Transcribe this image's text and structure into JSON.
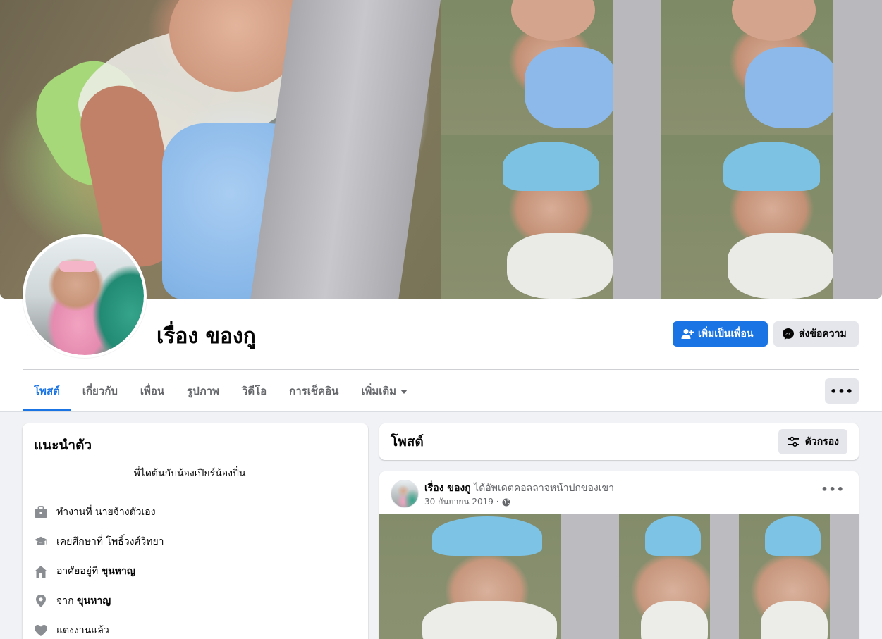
{
  "profile": {
    "name": "เรื่อง ของกู",
    "add_friend_label": "เพิ่มเป็นเพื่อน",
    "message_label": "ส่งข้อความ"
  },
  "tabs": [
    {
      "label": "โพสต์",
      "active": true
    },
    {
      "label": "เกี่ยวกับ",
      "active": false
    },
    {
      "label": "เพื่อน",
      "active": false
    },
    {
      "label": "รูปภาพ",
      "active": false
    },
    {
      "label": "วิดีโอ",
      "active": false
    },
    {
      "label": "การเช็คอิน",
      "active": false
    },
    {
      "label": "เพิ่มเติม",
      "active": false
    }
  ],
  "more_menu_label": "•••",
  "intro": {
    "title": "แนะนำตัว",
    "bio": "พี่ไดต้นกับน้องเปียร์น้องปิ่น",
    "items": [
      {
        "icon": "briefcase-icon",
        "prefix": "ทำงานที่ นายจ้างตัวเอง",
        "bold": ""
      },
      {
        "icon": "graduation-cap-icon",
        "prefix": "เคยศึกษาที่ โพธิ์วงศ์วิทยา",
        "bold": ""
      },
      {
        "icon": "home-icon",
        "prefix": "อาศัยอยู่ที่ ",
        "bold": "ขุนหาญ"
      },
      {
        "icon": "location-pin-icon",
        "prefix": "จาก ",
        "bold": "ขุนหาญ"
      },
      {
        "icon": "heart-icon",
        "prefix": "แต่งงานแล้ว",
        "bold": ""
      }
    ]
  },
  "posts_section": {
    "title": "โพสต์",
    "filter_label": "ตัวกรอง"
  },
  "post": {
    "author": "เรื่อง ของกู",
    "action": " ได้อัพเดตคอลลาจหน้าปกของเขา",
    "date": "30 กันยายน 2019 ·",
    "more_label": "•••",
    "privacy_icon": "globe-icon"
  },
  "colors": {
    "accent": "#1b74e4",
    "background": "#f0f2f5",
    "button_secondary": "#e4e6eb",
    "text_secondary": "#65676b"
  }
}
